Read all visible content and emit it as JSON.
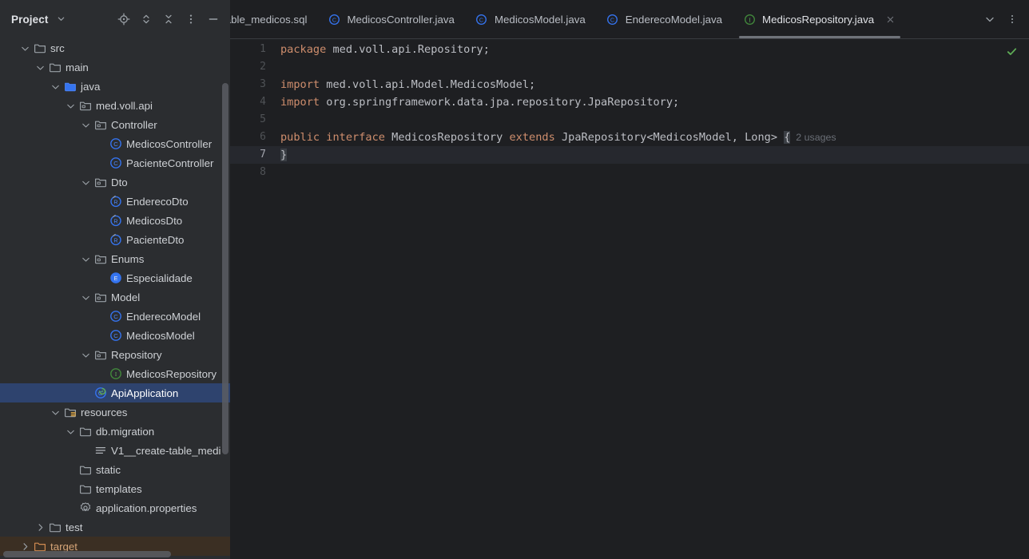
{
  "window": {
    "theme": "IntelliJ IDEA Dark",
    "bg": "#1e1f22",
    "panel_bg": "#2b2d30",
    "selection_blue": "#2e436e",
    "excluded_brown": "#3b2f23",
    "keyword_orange": "#cf8e6d",
    "text_gray": "#bcbec4"
  },
  "tool_window": {
    "title": "Project",
    "chevron_icon": "chevron-down-icon",
    "actions": [
      {
        "name": "select-opened-file-icon",
        "tooltip": "Select Opened File"
      },
      {
        "name": "expand-all-icon",
        "tooltip": "Expand All"
      },
      {
        "name": "collapse-all-icon",
        "tooltip": "Collapse All"
      },
      {
        "name": "more-options-icon",
        "tooltip": "Options"
      },
      {
        "name": "hide-icon",
        "tooltip": "Hide"
      }
    ]
  },
  "tabs": {
    "items": [
      {
        "label": "table_medicos.sql",
        "icon": "sql-file-icon",
        "active": false,
        "clipped": true
      },
      {
        "label": "MedicosController.java",
        "icon": "java-class-icon",
        "active": false,
        "clipped": false
      },
      {
        "label": "MedicosModel.java",
        "icon": "java-class-icon",
        "active": false,
        "clipped": false
      },
      {
        "label": "EnderecoModel.java",
        "icon": "java-class-icon",
        "active": false,
        "clipped": false
      },
      {
        "label": "MedicosRepository.java",
        "icon": "java-interface-icon",
        "active": true,
        "clipped": false
      }
    ],
    "close_icon": "close-icon",
    "actions": [
      {
        "name": "tab-list-chevron-icon",
        "tooltip": "Show Hidden Tabs"
      },
      {
        "name": "tab-options-icon",
        "tooltip": "Tab Options"
      }
    ]
  },
  "tree": {
    "rows": [
      {
        "label": "src",
        "indent": 1,
        "arrow": "down",
        "icon": "folder-icon",
        "state": "normal"
      },
      {
        "label": "main",
        "indent": 2,
        "arrow": "down",
        "icon": "folder-icon",
        "state": "normal"
      },
      {
        "label": "java",
        "indent": 3,
        "arrow": "down",
        "icon": "source-root-icon",
        "state": "normal"
      },
      {
        "label": "med.voll.api",
        "indent": 4,
        "arrow": "down",
        "icon": "package-icon",
        "state": "normal"
      },
      {
        "label": "Controller",
        "indent": 5,
        "arrow": "down",
        "icon": "package-icon",
        "state": "normal"
      },
      {
        "label": "MedicosController",
        "indent": 6,
        "arrow": "none",
        "icon": "java-class-icon",
        "state": "normal"
      },
      {
        "label": "PacienteController",
        "indent": 6,
        "arrow": "none",
        "icon": "java-class-icon",
        "state": "normal"
      },
      {
        "label": "Dto",
        "indent": 5,
        "arrow": "down",
        "icon": "package-icon",
        "state": "normal"
      },
      {
        "label": "EnderecoDto",
        "indent": 6,
        "arrow": "none",
        "icon": "java-record-icon",
        "state": "normal"
      },
      {
        "label": "MedicosDto",
        "indent": 6,
        "arrow": "none",
        "icon": "java-record-icon",
        "state": "normal"
      },
      {
        "label": "PacienteDto",
        "indent": 6,
        "arrow": "none",
        "icon": "java-record-icon",
        "state": "normal"
      },
      {
        "label": "Enums",
        "indent": 5,
        "arrow": "down",
        "icon": "package-icon",
        "state": "normal"
      },
      {
        "label": "Especialidade",
        "indent": 6,
        "arrow": "none",
        "icon": "java-enum-icon",
        "state": "normal"
      },
      {
        "label": "Model",
        "indent": 5,
        "arrow": "down",
        "icon": "package-icon",
        "state": "normal"
      },
      {
        "label": "EnderecoModel",
        "indent": 6,
        "arrow": "none",
        "icon": "java-class-icon",
        "state": "normal"
      },
      {
        "label": "MedicosModel",
        "indent": 6,
        "arrow": "none",
        "icon": "java-class-icon",
        "state": "normal"
      },
      {
        "label": "Repository",
        "indent": 5,
        "arrow": "down",
        "icon": "package-icon",
        "state": "normal"
      },
      {
        "label": "MedicosRepository",
        "indent": 6,
        "arrow": "none",
        "icon": "java-interface-icon",
        "state": "normal"
      },
      {
        "label": "ApiApplication",
        "indent": 5,
        "arrow": "none",
        "icon": "java-runnable-class-icon",
        "state": "selected"
      },
      {
        "label": "resources",
        "indent": 3,
        "arrow": "down",
        "icon": "resource-root-icon",
        "state": "normal"
      },
      {
        "label": "db.migration",
        "indent": 4,
        "arrow": "down",
        "icon": "folder-icon",
        "state": "normal"
      },
      {
        "label": "V1__create-table_medi",
        "indent": 5,
        "arrow": "none",
        "icon": "sql-file-icon-lines",
        "state": "normal"
      },
      {
        "label": "static",
        "indent": 4,
        "arrow": "none",
        "icon": "folder-icon",
        "state": "normal"
      },
      {
        "label": "templates",
        "indent": 4,
        "arrow": "none",
        "icon": "folder-icon",
        "state": "normal"
      },
      {
        "label": "application.properties",
        "indent": 4,
        "arrow": "none",
        "icon": "properties-file-icon",
        "state": "normal"
      },
      {
        "label": "test",
        "indent": 2,
        "arrow": "right",
        "icon": "folder-icon",
        "state": "normal"
      },
      {
        "label": "target",
        "indent": 1,
        "arrow": "right",
        "icon": "excluded-folder-icon",
        "state": "excluded"
      }
    ]
  },
  "editor": {
    "file": "MedicosRepository.java",
    "current_line": 7,
    "inspection_status_icon": "checkmark-ok-icon",
    "lines": [
      {
        "num": 1,
        "tokens": [
          {
            "t": "package",
            "c": "kw"
          },
          {
            "t": " med.voll.api.Repository;",
            "c": "plain"
          }
        ]
      },
      {
        "num": 2,
        "tokens": []
      },
      {
        "num": 3,
        "tokens": [
          {
            "t": "import",
            "c": "kw"
          },
          {
            "t": " med.voll.api.Model.MedicosModel;",
            "c": "plain"
          }
        ]
      },
      {
        "num": 4,
        "tokens": [
          {
            "t": "import",
            "c": "kw"
          },
          {
            "t": " org.springframework.data.jpa.repository.JpaRepository;",
            "c": "plain"
          }
        ]
      },
      {
        "num": 5,
        "tokens": []
      },
      {
        "num": 6,
        "tokens": [
          {
            "t": "public",
            "c": "kw"
          },
          {
            "t": " ",
            "c": "plain"
          },
          {
            "t": "interface",
            "c": "kw"
          },
          {
            "t": " ",
            "c": "plain"
          },
          {
            "t": "MedicosRepository",
            "c": "cls"
          },
          {
            "t": " ",
            "c": "plain"
          },
          {
            "t": "extends",
            "c": "kw"
          },
          {
            "t": " JpaRepository<MedicosModel, Long> ",
            "c": "plain"
          },
          {
            "t": "{",
            "c": "caret-brace"
          }
        ],
        "inlay": "2 usages"
      },
      {
        "num": 7,
        "tokens": [
          {
            "t": "}",
            "c": "caret-brace"
          }
        ]
      },
      {
        "num": 8,
        "tokens": []
      }
    ]
  }
}
